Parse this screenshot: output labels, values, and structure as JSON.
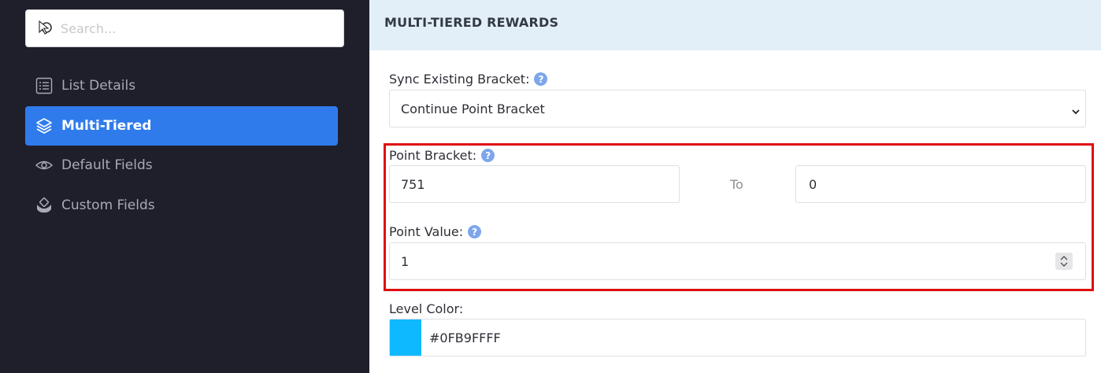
{
  "sidebar": {
    "search": {
      "placeholder": "Search..."
    },
    "items": [
      {
        "label": "List Details",
        "icon": "list-icon",
        "active": false
      },
      {
        "label": "Multi-Tiered",
        "icon": "layers-icon",
        "active": true
      },
      {
        "label": "Default Fields",
        "icon": "eye-icon",
        "active": false
      },
      {
        "label": "Custom Fields",
        "icon": "hand-holding-icon",
        "active": false
      }
    ]
  },
  "main": {
    "header": {
      "title": "MULTI-TIERED REWARDS"
    },
    "sync": {
      "label": "Sync Existing Bracket:",
      "value": "Continue Point Bracket"
    },
    "point_bracket": {
      "label": "Point Bracket:",
      "from": "751",
      "to_label": "To",
      "to": "0"
    },
    "point_value": {
      "label": "Point Value:",
      "value": "1"
    },
    "level_color": {
      "label": "Level Color:",
      "value": "#0FB9FFFF",
      "swatch": "#0FB9FF"
    }
  },
  "colors": {
    "sidebar_bg": "#1f1f2b",
    "active_item": "#2f7bec",
    "header_bg": "#e3eff8",
    "highlight": "#e00d0d"
  }
}
